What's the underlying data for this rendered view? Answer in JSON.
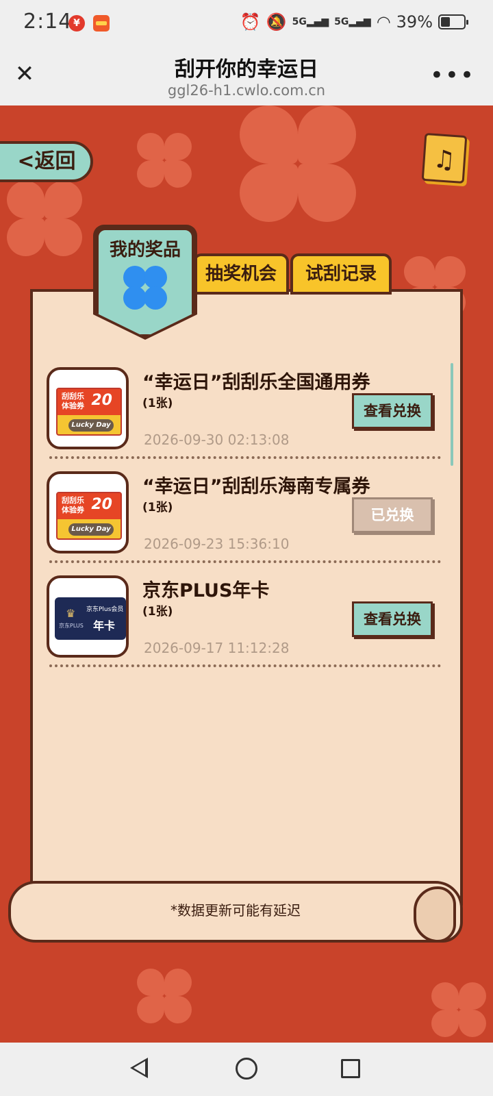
{
  "status_bar": {
    "time": "2:14",
    "signal_1": "5G",
    "signal_2": "5G",
    "battery": "39%"
  },
  "title_bar": {
    "title": "刮开你的幸运日",
    "url": "ggl26-h1.cwlo.com.cn",
    "close_glyph": "✕",
    "more_glyph": "•••"
  },
  "page": {
    "back_label": "<返回",
    "tabs": {
      "active": "我的奖品",
      "chances": "抽奖机会",
      "records": "试刮记录"
    },
    "ticket": {
      "line1": "刮刮乐",
      "line2": "体验券",
      "amount": "20",
      "brand": "Lucky Day"
    },
    "jd": {
      "member": "京东Plus会员",
      "plus": "京东PLUS",
      "year": "年卡"
    },
    "prizes": [
      {
        "name": "“幸运日”刮刮乐全国通用券",
        "qty": "(1张)",
        "time": "2026-09-30 02:13:08",
        "button": "查看兑换",
        "redeemed": false
      },
      {
        "name": "“幸运日”刮刮乐海南专属券",
        "qty": "(1张)",
        "time": "2026-09-23 15:36:10",
        "button": "已兑换",
        "redeemed": true
      },
      {
        "name": "京东PLUS年卡",
        "qty": "(1张)",
        "time": "2026-09-17 11:12:28",
        "button": "查看兑换",
        "redeemed": false
      }
    ],
    "note": "*数据更新可能有延迟"
  },
  "colors": {
    "background": "#c9432a",
    "accent_teal": "#99d6c8",
    "tab_yellow": "#f8c42a",
    "card": "#f7dec6"
  },
  "icons": [
    "close-icon",
    "more-icon",
    "music-icon",
    "clover-icon",
    "nav-back-icon",
    "nav-home-icon",
    "nav-recent-icon"
  ]
}
